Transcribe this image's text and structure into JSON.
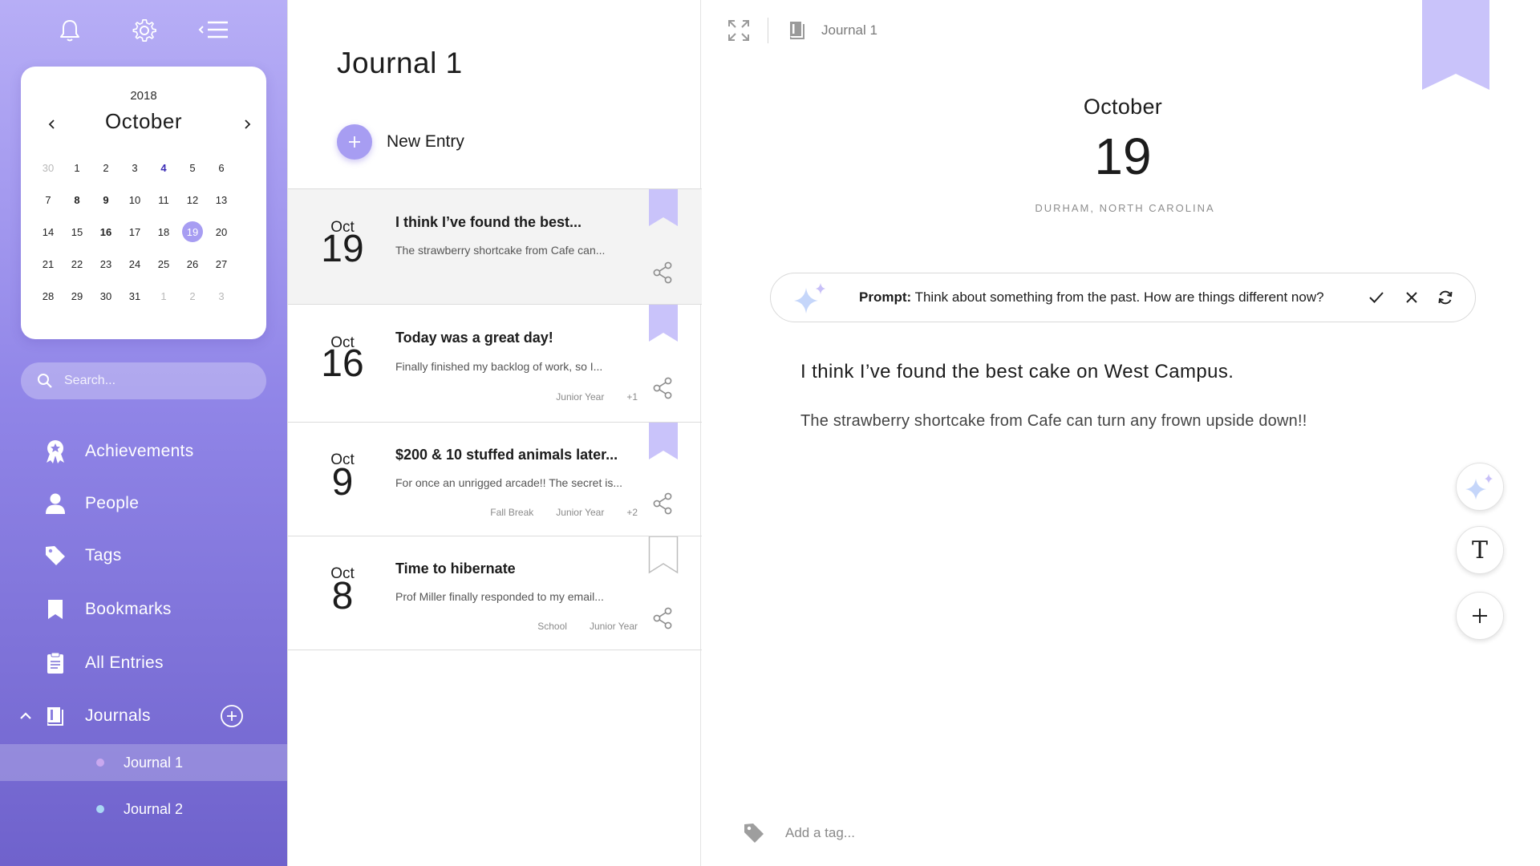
{
  "sidebar": {
    "calendar": {
      "year": "2018",
      "month": "October",
      "days": [
        {
          "label": "30",
          "state": "muted"
        },
        {
          "label": "1",
          "state": ""
        },
        {
          "label": "2",
          "state": ""
        },
        {
          "label": "3",
          "state": ""
        },
        {
          "label": "4",
          "state": "today"
        },
        {
          "label": "5",
          "state": ""
        },
        {
          "label": "6",
          "state": ""
        },
        {
          "label": "7",
          "state": ""
        },
        {
          "label": "8",
          "state": "bold"
        },
        {
          "label": "9",
          "state": "bold"
        },
        {
          "label": "10",
          "state": ""
        },
        {
          "label": "11",
          "state": ""
        },
        {
          "label": "12",
          "state": ""
        },
        {
          "label": "13",
          "state": ""
        },
        {
          "label": "14",
          "state": ""
        },
        {
          "label": "15",
          "state": ""
        },
        {
          "label": "16",
          "state": "bold"
        },
        {
          "label": "17",
          "state": ""
        },
        {
          "label": "18",
          "state": ""
        },
        {
          "label": "19",
          "state": "selected"
        },
        {
          "label": "20",
          "state": ""
        },
        {
          "label": "21",
          "state": ""
        },
        {
          "label": "22",
          "state": ""
        },
        {
          "label": "23",
          "state": ""
        },
        {
          "label": "24",
          "state": ""
        },
        {
          "label": "25",
          "state": ""
        },
        {
          "label": "26",
          "state": ""
        },
        {
          "label": "27",
          "state": ""
        },
        {
          "label": "28",
          "state": ""
        },
        {
          "label": "29",
          "state": ""
        },
        {
          "label": "30",
          "state": ""
        },
        {
          "label": "31",
          "state": ""
        },
        {
          "label": "1",
          "state": "muted"
        },
        {
          "label": "2",
          "state": "muted"
        },
        {
          "label": "3",
          "state": "muted"
        }
      ]
    },
    "search_placeholder": "Search...",
    "nav": {
      "achievements": "Achievements",
      "people": "People",
      "tags": "Tags",
      "bookmarks": "Bookmarks",
      "all_entries": "All Entries",
      "journals": "Journals"
    },
    "journals": [
      {
        "label": "Journal 1",
        "dot_color": "#c9a8ef"
      },
      {
        "label": "Journal 2",
        "dot_color": "#a9d7f4"
      }
    ]
  },
  "list": {
    "title": "Journal 1",
    "new_entry_label": "New Entry",
    "entries": [
      {
        "month": "Oct",
        "day": "19",
        "title": "I think I’ve found the best...",
        "preview": "The strawberry shortcake from Cafe can...",
        "tags": [],
        "bookmarked": true
      },
      {
        "month": "Oct",
        "day": "16",
        "title": "Today was a great day!",
        "preview": "Finally finished my backlog of work, so I...",
        "tags": [
          "Junior Year",
          "+1"
        ],
        "bookmarked": true
      },
      {
        "month": "Oct",
        "day": "9",
        "title": "$200 & 10 stuffed animals later...",
        "preview": "For once an unrigged arcade!! The secret is...",
        "tags": [
          "Fall Break",
          "Junior Year",
          "+2"
        ],
        "bookmarked": true
      },
      {
        "month": "Oct",
        "day": "8",
        "title": "Time to hibernate",
        "preview": "Prof Miller finally responded to my email...",
        "tags": [
          "School",
          "Junior Year"
        ],
        "bookmarked": false
      }
    ]
  },
  "editor": {
    "breadcrumb": "Journal 1",
    "month": "October",
    "day": "19",
    "location": "DURHAM, NORTH CAROLINA",
    "prompt": {
      "label": "Prompt:",
      "text": "Think about something from the past. How are things different now?"
    },
    "entry_title": "I think I’ve found the best cake on West Campus.",
    "entry_body": "The strawberry shortcake from Cafe can turn any frown upside down!!",
    "text_tool_glyph": "T",
    "tag_placeholder": "Add a tag..."
  },
  "colors": {
    "accent": "#a79df2",
    "sidebar_top": "#b7aef6",
    "sidebar_bottom": "#6f62cc",
    "bookmark": "#c9c3fa"
  },
  "icons": [
    "bell-icon",
    "gear-icon",
    "collapse-menu-icon",
    "chevron-left-icon",
    "chevron-right-icon",
    "search-icon",
    "award-icon",
    "person-icon",
    "tag-icon",
    "bookmark-icon",
    "document-icon",
    "book-icon",
    "chevron-up-icon",
    "plus-circle-icon",
    "share-icon",
    "expand-icon",
    "sparkle-icon",
    "check-icon",
    "close-icon",
    "refresh-icon",
    "text-format-icon",
    "plus-icon"
  ]
}
